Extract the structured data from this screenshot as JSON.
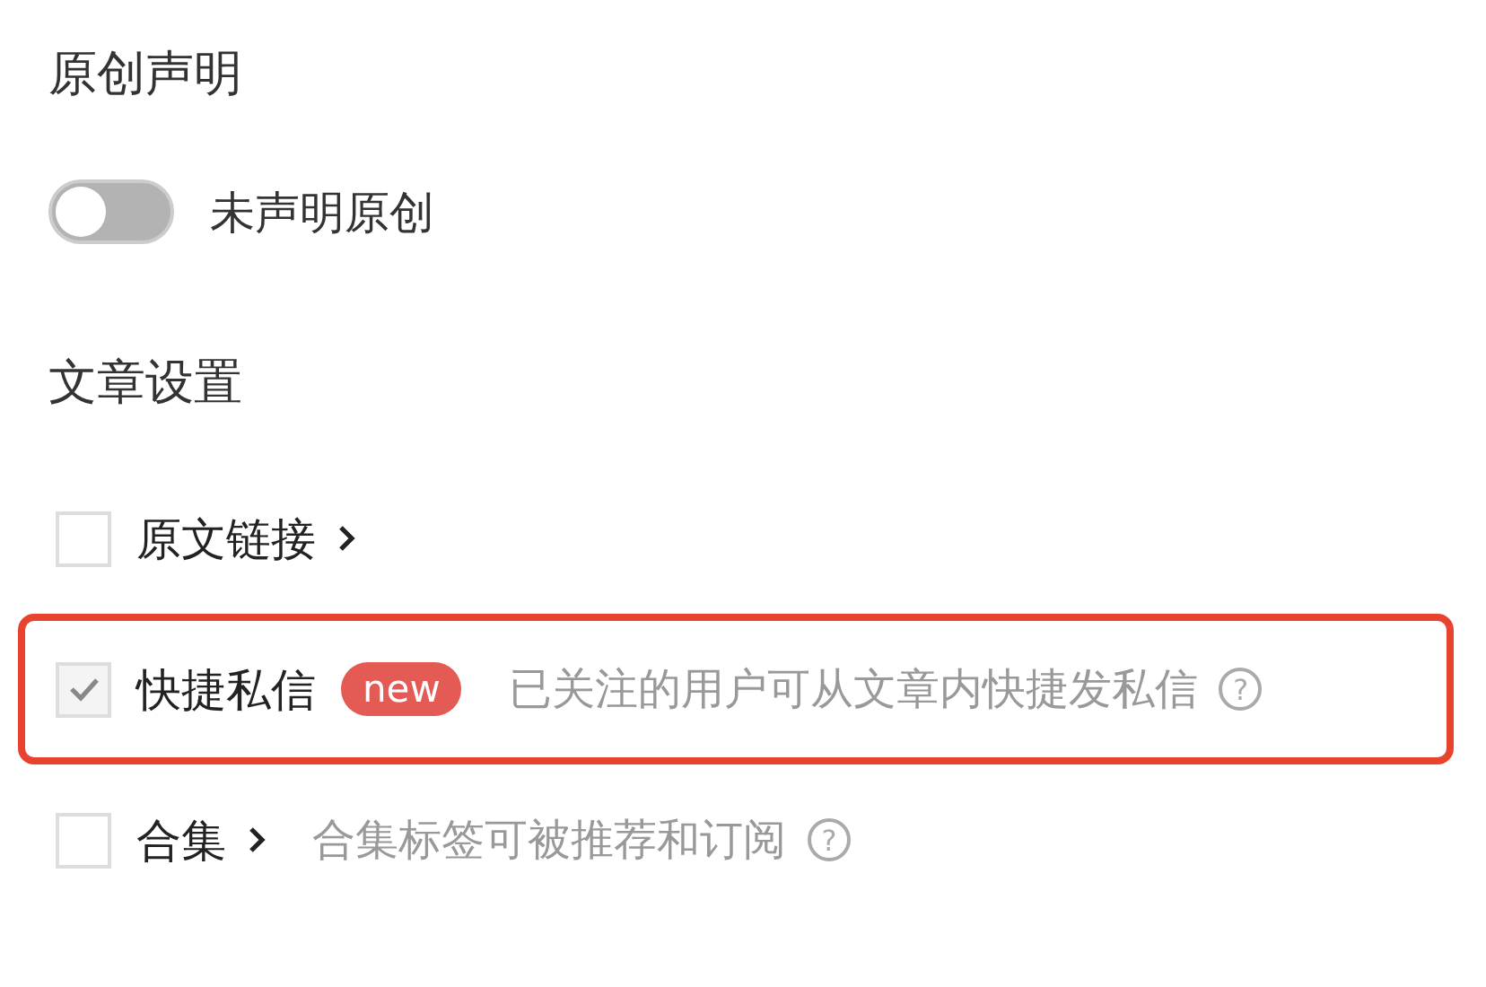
{
  "original_section": {
    "title": "原创声明",
    "toggle": {
      "on": false,
      "label": "未声明原创"
    }
  },
  "article_settings": {
    "title": "文章设置",
    "items": [
      {
        "label": "原文链接",
        "checked": false,
        "has_arrow": true,
        "highlighted": false
      },
      {
        "label": "快捷私信",
        "checked": true,
        "has_arrow": false,
        "badge": "new",
        "description": "已关注的用户可从文章内快捷发私信",
        "help": "?",
        "highlighted": true
      },
      {
        "label": "合集",
        "checked": false,
        "has_arrow": true,
        "description": "合集标签可被推荐和订阅",
        "help": "?",
        "highlighted": false
      }
    ]
  }
}
